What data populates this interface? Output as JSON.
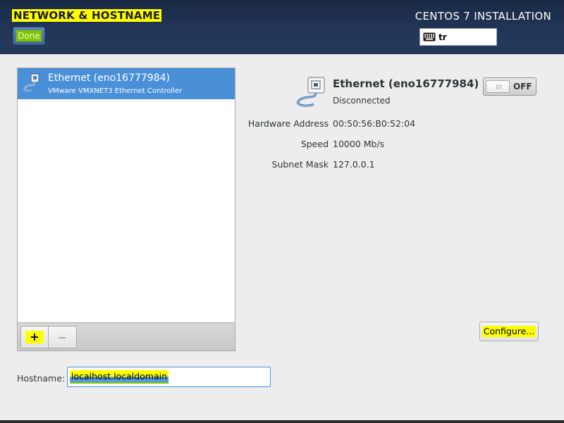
{
  "header": {
    "title": "NETWORK & HOSTNAME",
    "done_label": "Done",
    "install_title": "CENTOS 7 INSTALLATION",
    "keyboard_layout": "tr",
    "keyboard_icon": "keyboard-icon"
  },
  "device_list": {
    "items": [
      {
        "name": "Ethernet (eno16777984)",
        "description": "VMware VMXNET3 Ethernet Controller",
        "icon": "ethernet-cable-icon",
        "selected": true
      }
    ],
    "add_label": "+",
    "remove_label": "−"
  },
  "detail": {
    "name": "Ethernet (eno16777984)",
    "status": "Disconnected",
    "toggle_label": "OFF",
    "toggle_on": false,
    "properties": [
      {
        "label": "Hardware Address",
        "value": "00:50:56:B0:52:04"
      },
      {
        "label": "Speed",
        "value": "10000 Mb/s"
      },
      {
        "label": "Subnet Mask",
        "value": "127.0.0.1"
      }
    ],
    "configure_label": "Configure..."
  },
  "hostname": {
    "label": "Hostname:",
    "value": "localhost.localdomain"
  },
  "colors": {
    "header_bg": "#223658",
    "selection": "#4a90d9",
    "highlight": "#ffff00"
  }
}
